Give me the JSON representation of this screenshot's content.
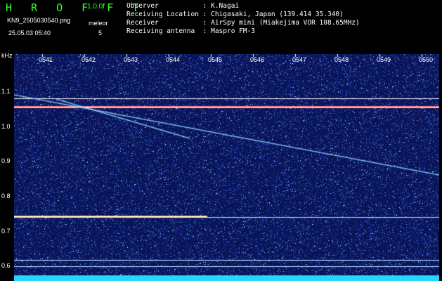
{
  "header": {
    "logo": "H R O F F T",
    "version": "1.0.0f",
    "filename": "KN9_2505030540.png",
    "mode_label": "meleor",
    "mode_value": "5",
    "datetime": "25.05.03 05:40"
  },
  "meta": [
    {
      "label": "Observer           ",
      "value": ": K.Nagai"
    },
    {
      "label": "Receiving Location ",
      "value": ": Chigasaki, Japan (139.414 35.340)"
    },
    {
      "label": "Receiver           ",
      "value": ": AirSpy mini (Miakejima VOR 108.65MHz)"
    },
    {
      "label": "Receiving antenna  ",
      "value": ": Maspro FM-3"
    }
  ],
  "axis": {
    "unit": "kHz",
    "y_labels": [
      "1.1",
      "1.0",
      "0.9",
      "0.8",
      "0.7",
      "0.6"
    ],
    "time_labels": [
      "0541",
      "0542",
      "0543",
      "0544",
      "0545",
      "0546",
      "0547",
      "0548",
      "0549",
      "0550"
    ]
  },
  "colors": {
    "bg": "#0a1458",
    "accent": "#33ff33",
    "line": "#22d8ff"
  }
}
